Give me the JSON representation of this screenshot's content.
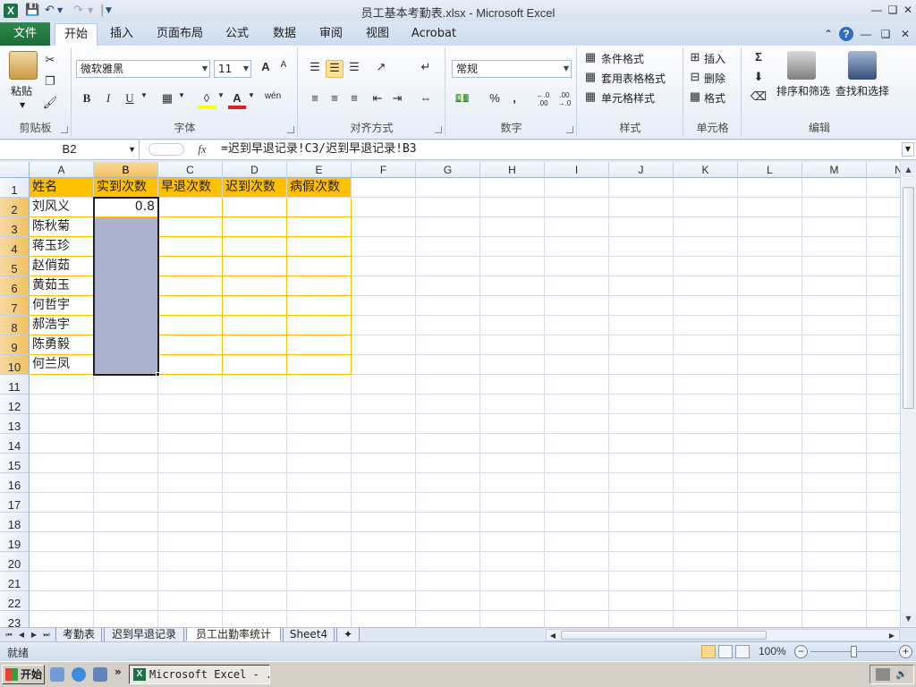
{
  "titlebar": {
    "app_icon": "X",
    "title": "员工基本考勤表.xlsx  -  Microsoft Excel",
    "qat_icons": [
      "save-icon",
      "undo-icon",
      "redo-icon",
      "customize-qat-icon"
    ]
  },
  "ribbon_tabs": {
    "file": "文件",
    "tabs": [
      "开始",
      "插入",
      "页面布局",
      "公式",
      "数据",
      "审阅",
      "视图",
      "Acrobat"
    ],
    "active": "开始"
  },
  "ribbon": {
    "clipboard": {
      "label": "剪贴板",
      "paste": "粘贴"
    },
    "font": {
      "label": "字体",
      "font_name": "微软雅黑",
      "font_size": "11",
      "bold": "B",
      "italic": "I",
      "underline": "U",
      "grow": "A",
      "shrink": "A",
      "font_color": "A",
      "phonetic": "wén"
    },
    "alignment": {
      "label": "对齐方式"
    },
    "number": {
      "label": "数字",
      "format": "常规",
      "percent": "%",
      "comma": ",",
      "inc_decimal": "←.0 .00",
      "dec_decimal": ".00 →.0"
    },
    "styles": {
      "label": "样式",
      "conditional": "条件格式",
      "table": "套用表格格式",
      "cell_styles": "单元格样式"
    },
    "cells": {
      "label": "单元格",
      "insert": "插入",
      "delete": "删除",
      "format": "格式"
    },
    "editing": {
      "label": "编辑",
      "autosum": "Σ",
      "sort_filter": "排序和筛选",
      "find_select": "查找和选择"
    }
  },
  "formula_bar": {
    "name_box": "B2",
    "fx": "fx",
    "formula": "=迟到早退记录!C3/迟到早退记录!B3"
  },
  "grid": {
    "columns": [
      "A",
      "B",
      "C",
      "D",
      "E",
      "F",
      "G",
      "H",
      "I",
      "J",
      "K",
      "L",
      "M",
      "N"
    ],
    "rows": [
      "1",
      "2",
      "3",
      "4",
      "5",
      "6",
      "7",
      "8",
      "9",
      "10",
      "11",
      "12",
      "13",
      "14",
      "15",
      "16",
      "17",
      "18",
      "19",
      "20",
      "21",
      "22",
      "23"
    ],
    "headers": [
      "姓名",
      "实到次数",
      "早退次数",
      "迟到次数",
      "病假次数"
    ],
    "names": [
      "刘风义",
      "陈秋菊",
      "蒋玉珍",
      "赵俏茹",
      "黄茹玉",
      "何哲宇",
      "郝浩宇",
      "陈勇毅",
      "何兰凤"
    ],
    "b2_value": "0.8",
    "selected_column": "B",
    "selected_range": "B2:B10"
  },
  "sheet_tabs": {
    "tabs": [
      "考勤表",
      "迟到早退记录",
      "员工出勤率统计",
      "Sheet4"
    ],
    "active": "员工出勤率统计"
  },
  "statusbar": {
    "status": "就绪",
    "zoom": "100%",
    "zoom_out": "−",
    "zoom_in": "+"
  },
  "taskbar": {
    "start": "开始",
    "task_button": "Microsoft Excel - ...",
    "overflow": "»"
  },
  "colors": {
    "header_fill": "#ffc000",
    "selection_fill": "#aab2cd",
    "file_tab": "#1e7145"
  }
}
